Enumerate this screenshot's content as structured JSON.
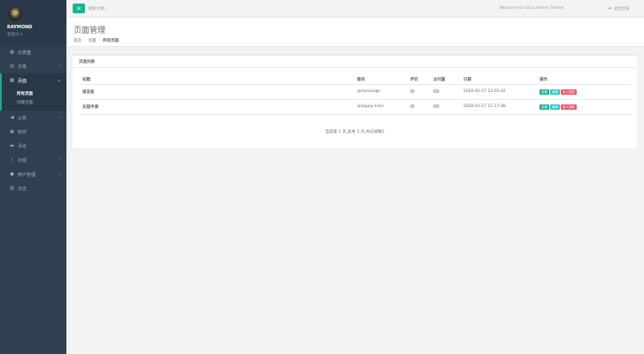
{
  "sidebar": {
    "username": "RAYMOND",
    "role": "管理员 ▾",
    "items": [
      {
        "label": "仪表盘",
        "icon": "dashboard-icon",
        "glyph": "▦",
        "arrow": ""
      },
      {
        "label": "文章",
        "icon": "book-icon",
        "glyph": "▤",
        "arrow": "‹"
      },
      {
        "label": "页面",
        "icon": "file-icon",
        "glyph": "▥",
        "arrow": "⌄"
      },
      {
        "label": "公告",
        "icon": "bullhorn-icon",
        "glyph": "◀",
        "arrow": "‹"
      },
      {
        "label": "附件",
        "icon": "image-icon",
        "glyph": "▣",
        "arrow": ""
      },
      {
        "label": "评论",
        "icon": "comment-icon",
        "glyph": "▬",
        "arrow": ""
      },
      {
        "label": "外观",
        "icon": "brush-icon",
        "glyph": "/",
        "arrow": "‹"
      },
      {
        "label": "用户管理",
        "icon": "user-icon",
        "glyph": "●",
        "arrow": "‹"
      },
      {
        "label": "日志",
        "icon": "log-icon",
        "glyph": "▧",
        "arrow": ""
      }
    ],
    "subitems": [
      {
        "label": "所有页面"
      },
      {
        "label": "创建页面"
      }
    ]
  },
  "topbar": {
    "menu_glyph": "≡",
    "search_placeholder": "搜索文章...",
    "welcome": "Welcome to SoLio Admin Theme.",
    "logout": "退出登录",
    "logout_glyph": "⇥"
  },
  "heading": {
    "title": "页面管理",
    "breadcrumb": [
      "首页",
      "页面",
      "所有页面"
    ],
    "separator": "/"
  },
  "panel": {
    "title": "页面列表",
    "columns": [
      "标题",
      "路径",
      "评论",
      "访问量",
      "日期",
      "操作"
    ],
    "rows": [
      {
        "title": "留言板",
        "path": "/p/message",
        "comments": "0",
        "views": "25",
        "date": "2020-02-27 22:05:42"
      },
      {
        "title": "友链申请",
        "path": "/p/apply-links",
        "comments": "0",
        "views": "26",
        "date": "2020-02-27 21:17:48"
      }
    ],
    "actions": {
      "view": "查看",
      "edit": "编辑",
      "trash": "丢入回收"
    },
    "pagination": "当前第 1 页,总共 1 页,共记录数2"
  },
  "colors": {
    "sidebar": "#2f4050",
    "accent": "#1ab394",
    "edit": "#23c6c8",
    "danger": "#ed5565"
  }
}
